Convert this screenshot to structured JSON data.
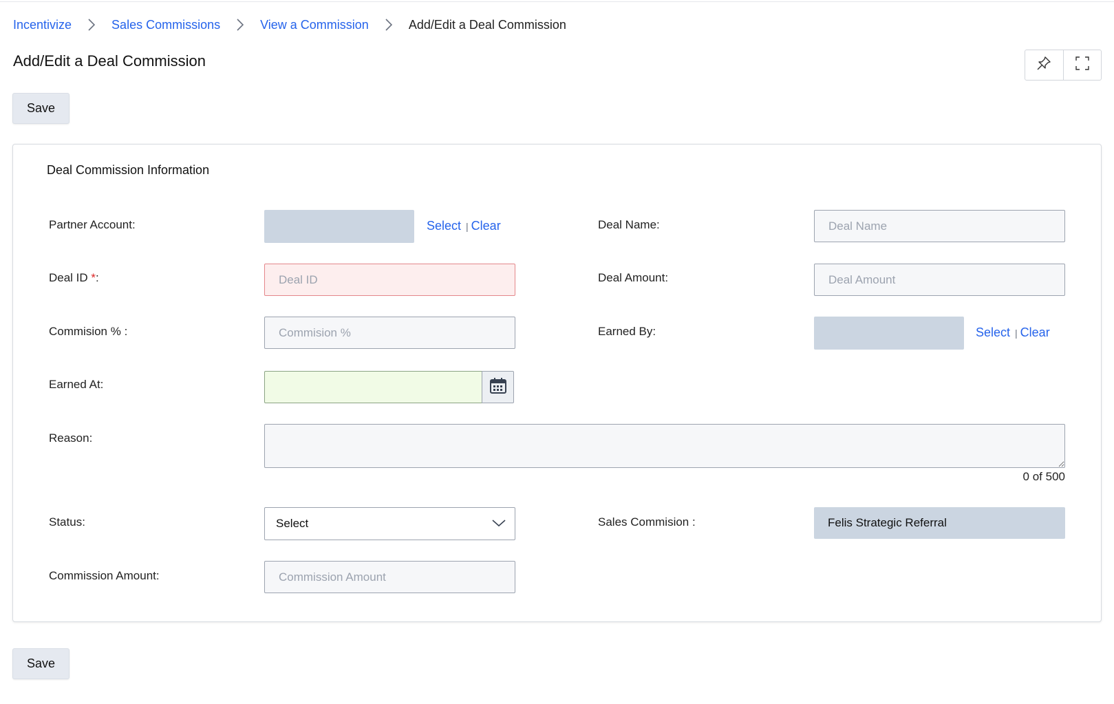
{
  "breadcrumb": {
    "items": [
      "Incentivize",
      "Sales Commissions",
      "View a Commission"
    ],
    "current": "Add/Edit a Deal Commission"
  },
  "page": {
    "title": "Add/Edit a Deal Commission"
  },
  "toolbar": {
    "save_label": "Save",
    "pin_icon": "pin-icon",
    "fullscreen_icon": "fullscreen-icon"
  },
  "section": {
    "title": "Deal Commission Information"
  },
  "form": {
    "partner_account": {
      "label": "Partner Account:",
      "select": "Select",
      "clear": "Clear"
    },
    "deal_name": {
      "label": "Deal Name:",
      "placeholder": "Deal Name",
      "value": ""
    },
    "deal_id": {
      "label": "Deal ID",
      "required_mark": "*",
      "label_suffix": ":",
      "placeholder": "Deal ID",
      "value": ""
    },
    "deal_amount": {
      "label": "Deal Amount:",
      "placeholder": "Deal Amount",
      "value": ""
    },
    "commission_pct": {
      "label": "Commision % :",
      "placeholder": "Commision %",
      "value": ""
    },
    "earned_by": {
      "label": "Earned By:",
      "select": "Select",
      "clear": "Clear"
    },
    "earned_at": {
      "label": "Earned At:",
      "value": "",
      "icon": "calendar-icon"
    },
    "reason": {
      "label": "Reason:",
      "value": "",
      "counter": "0 of 500"
    },
    "status": {
      "label": "Status:",
      "selected": "Select"
    },
    "sales_commission": {
      "label": "Sales Commision :",
      "value": "Felis Strategic Referral"
    },
    "commission_amount": {
      "label": "Commission Amount:",
      "placeholder": "Commission Amount",
      "value": ""
    }
  },
  "colors": {
    "link": "#2563eb",
    "required": "#dc2626",
    "error_bg": "#fdeeee",
    "date_bg": "#f1fbe6",
    "lookup_bg": "#cbd5e1"
  }
}
